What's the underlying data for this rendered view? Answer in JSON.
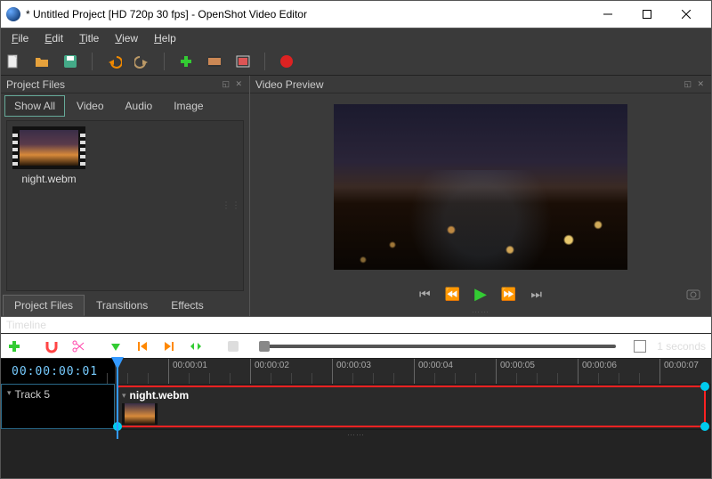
{
  "window": {
    "title": "* Untitled Project [HD 720p 30 fps] - OpenShot Video Editor"
  },
  "menu": {
    "items": [
      "File",
      "Edit",
      "Title",
      "View",
      "Help"
    ]
  },
  "toolbar": {
    "items": [
      "new-project",
      "open-project",
      "save-project",
      "undo",
      "redo",
      "import-files",
      "choose-layout",
      "fullscreen",
      "export-video"
    ]
  },
  "panels": {
    "project_files": {
      "title": "Project Files",
      "filters": {
        "show_all": "Show All",
        "video": "Video",
        "audio": "Audio",
        "image": "Image"
      },
      "files": [
        {
          "name": "night.webm"
        }
      ],
      "tabs": {
        "project_files": "Project Files",
        "transitions": "Transitions",
        "effects": "Effects"
      }
    },
    "preview": {
      "title": "Video Preview"
    },
    "timeline": {
      "title": "Timeline",
      "zoom_label": "1 seconds",
      "playhead_time": "00:00:00:01",
      "ruler_labels": [
        "00:00:01",
        "00:00:02",
        "00:00:03",
        "00:00:04",
        "00:00:05",
        "00:00:06",
        "00:00:07"
      ],
      "tracks": [
        {
          "name": "Track 5"
        }
      ],
      "clips": [
        {
          "name": "night.webm",
          "track": 0
        }
      ]
    }
  },
  "colors": {
    "accent": "#39f",
    "play": "#2c2",
    "record": "#d22",
    "clip_border": "#f22"
  }
}
